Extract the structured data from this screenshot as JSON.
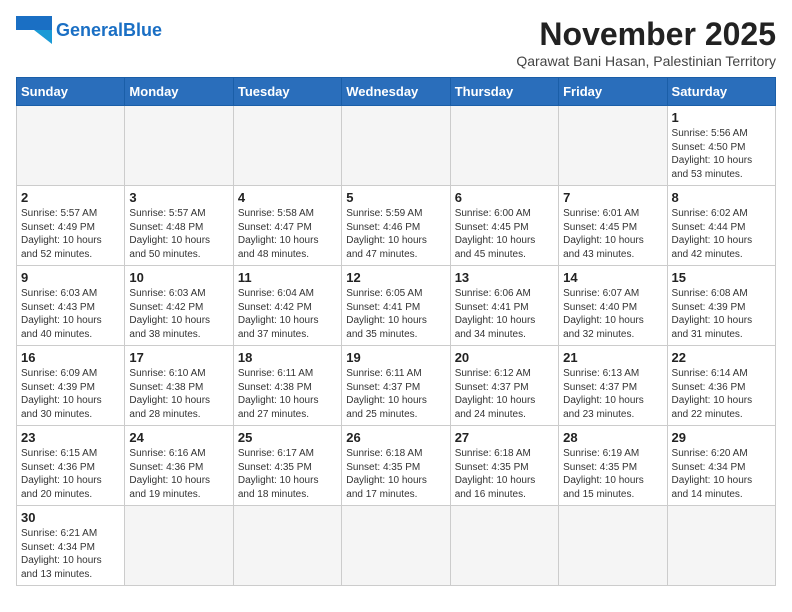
{
  "logo": {
    "general": "General",
    "blue": "Blue"
  },
  "header": {
    "month_year": "November 2025",
    "location": "Qarawat Bani Hasan, Palestinian Territory"
  },
  "weekdays": [
    "Sunday",
    "Monday",
    "Tuesday",
    "Wednesday",
    "Thursday",
    "Friday",
    "Saturday"
  ],
  "weeks": [
    [
      {
        "day": "",
        "info": ""
      },
      {
        "day": "",
        "info": ""
      },
      {
        "day": "",
        "info": ""
      },
      {
        "day": "",
        "info": ""
      },
      {
        "day": "",
        "info": ""
      },
      {
        "day": "",
        "info": ""
      },
      {
        "day": "1",
        "info": "Sunrise: 5:56 AM\nSunset: 4:50 PM\nDaylight: 10 hours\nand 53 minutes."
      }
    ],
    [
      {
        "day": "2",
        "info": "Sunrise: 5:57 AM\nSunset: 4:49 PM\nDaylight: 10 hours\nand 52 minutes."
      },
      {
        "day": "3",
        "info": "Sunrise: 5:57 AM\nSunset: 4:48 PM\nDaylight: 10 hours\nand 50 minutes."
      },
      {
        "day": "4",
        "info": "Sunrise: 5:58 AM\nSunset: 4:47 PM\nDaylight: 10 hours\nand 48 minutes."
      },
      {
        "day": "5",
        "info": "Sunrise: 5:59 AM\nSunset: 4:46 PM\nDaylight: 10 hours\nand 47 minutes."
      },
      {
        "day": "6",
        "info": "Sunrise: 6:00 AM\nSunset: 4:45 PM\nDaylight: 10 hours\nand 45 minutes."
      },
      {
        "day": "7",
        "info": "Sunrise: 6:01 AM\nSunset: 4:45 PM\nDaylight: 10 hours\nand 43 minutes."
      },
      {
        "day": "8",
        "info": "Sunrise: 6:02 AM\nSunset: 4:44 PM\nDaylight: 10 hours\nand 42 minutes."
      }
    ],
    [
      {
        "day": "9",
        "info": "Sunrise: 6:03 AM\nSunset: 4:43 PM\nDaylight: 10 hours\nand 40 minutes."
      },
      {
        "day": "10",
        "info": "Sunrise: 6:03 AM\nSunset: 4:42 PM\nDaylight: 10 hours\nand 38 minutes."
      },
      {
        "day": "11",
        "info": "Sunrise: 6:04 AM\nSunset: 4:42 PM\nDaylight: 10 hours\nand 37 minutes."
      },
      {
        "day": "12",
        "info": "Sunrise: 6:05 AM\nSunset: 4:41 PM\nDaylight: 10 hours\nand 35 minutes."
      },
      {
        "day": "13",
        "info": "Sunrise: 6:06 AM\nSunset: 4:41 PM\nDaylight: 10 hours\nand 34 minutes."
      },
      {
        "day": "14",
        "info": "Sunrise: 6:07 AM\nSunset: 4:40 PM\nDaylight: 10 hours\nand 32 minutes."
      },
      {
        "day": "15",
        "info": "Sunrise: 6:08 AM\nSunset: 4:39 PM\nDaylight: 10 hours\nand 31 minutes."
      }
    ],
    [
      {
        "day": "16",
        "info": "Sunrise: 6:09 AM\nSunset: 4:39 PM\nDaylight: 10 hours\nand 30 minutes."
      },
      {
        "day": "17",
        "info": "Sunrise: 6:10 AM\nSunset: 4:38 PM\nDaylight: 10 hours\nand 28 minutes."
      },
      {
        "day": "18",
        "info": "Sunrise: 6:11 AM\nSunset: 4:38 PM\nDaylight: 10 hours\nand 27 minutes."
      },
      {
        "day": "19",
        "info": "Sunrise: 6:11 AM\nSunset: 4:37 PM\nDaylight: 10 hours\nand 25 minutes."
      },
      {
        "day": "20",
        "info": "Sunrise: 6:12 AM\nSunset: 4:37 PM\nDaylight: 10 hours\nand 24 minutes."
      },
      {
        "day": "21",
        "info": "Sunrise: 6:13 AM\nSunset: 4:37 PM\nDaylight: 10 hours\nand 23 minutes."
      },
      {
        "day": "22",
        "info": "Sunrise: 6:14 AM\nSunset: 4:36 PM\nDaylight: 10 hours\nand 22 minutes."
      }
    ],
    [
      {
        "day": "23",
        "info": "Sunrise: 6:15 AM\nSunset: 4:36 PM\nDaylight: 10 hours\nand 20 minutes."
      },
      {
        "day": "24",
        "info": "Sunrise: 6:16 AM\nSunset: 4:36 PM\nDaylight: 10 hours\nand 19 minutes."
      },
      {
        "day": "25",
        "info": "Sunrise: 6:17 AM\nSunset: 4:35 PM\nDaylight: 10 hours\nand 18 minutes."
      },
      {
        "day": "26",
        "info": "Sunrise: 6:18 AM\nSunset: 4:35 PM\nDaylight: 10 hours\nand 17 minutes."
      },
      {
        "day": "27",
        "info": "Sunrise: 6:18 AM\nSunset: 4:35 PM\nDaylight: 10 hours\nand 16 minutes."
      },
      {
        "day": "28",
        "info": "Sunrise: 6:19 AM\nSunset: 4:35 PM\nDaylight: 10 hours\nand 15 minutes."
      },
      {
        "day": "29",
        "info": "Sunrise: 6:20 AM\nSunset: 4:34 PM\nDaylight: 10 hours\nand 14 minutes."
      }
    ],
    [
      {
        "day": "30",
        "info": "Sunrise: 6:21 AM\nSunset: 4:34 PM\nDaylight: 10 hours\nand 13 minutes."
      },
      {
        "day": "",
        "info": ""
      },
      {
        "day": "",
        "info": ""
      },
      {
        "day": "",
        "info": ""
      },
      {
        "day": "",
        "info": ""
      },
      {
        "day": "",
        "info": ""
      },
      {
        "day": "",
        "info": ""
      }
    ]
  ]
}
